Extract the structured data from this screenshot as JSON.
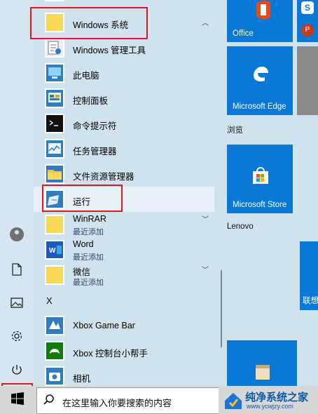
{
  "colors": {
    "accent": "#0a78d7",
    "highlight_box": "#e2171e",
    "panel_bg": "#cfe3ef"
  },
  "app_list": {
    "partial_top_item": "Windows 系统",
    "items": [
      {
        "label": "Windows 系统",
        "icon": "folder-icon",
        "expand": "collapse-chevron-icon"
      },
      {
        "label": "Windows 管理工具",
        "icon": "admin-tools-icon"
      },
      {
        "label": "此电脑",
        "icon": "computer-icon"
      },
      {
        "label": "控制面板",
        "icon": "control-panel-icon"
      },
      {
        "label": "命令提示符",
        "icon": "cmd-icon"
      },
      {
        "label": "任务管理器",
        "icon": "task-manager-icon"
      },
      {
        "label": "文件资源管理器",
        "icon": "file-explorer-icon"
      },
      {
        "label": "运行",
        "icon": "run-icon"
      },
      {
        "label": "WinRAR",
        "sub": "最近添加",
        "icon": "folder-icon"
      },
      {
        "label": "Word",
        "sub": "最近添加",
        "icon": "word-icon"
      },
      {
        "label": "微信",
        "sub": "最近添加",
        "icon": "folder-icon"
      },
      {
        "label": "Xbox Game Bar",
        "icon": "xbox-icon"
      },
      {
        "label": "Xbox 控制台小帮手",
        "icon": "xbox-companion-icon"
      },
      {
        "label": "相机",
        "icon": "camera-icon"
      }
    ],
    "section_letter": "X"
  },
  "rail": {
    "icons": [
      "user-avatar-icon",
      "document-icon",
      "pictures-icon",
      "settings-icon",
      "power-icon"
    ]
  },
  "tiles": {
    "office": "Office",
    "edge": "Microsoft Edge",
    "group_browse": "浏览",
    "store": "Microsoft Store",
    "group_lenovo": "Lenovo",
    "partial_tile": "联想"
  },
  "taskbar": {
    "search_placeholder": "在这里输入你要搜索的内容",
    "brand_title": "纯净系统之家",
    "brand_url": "www.ycwjzy.com"
  }
}
